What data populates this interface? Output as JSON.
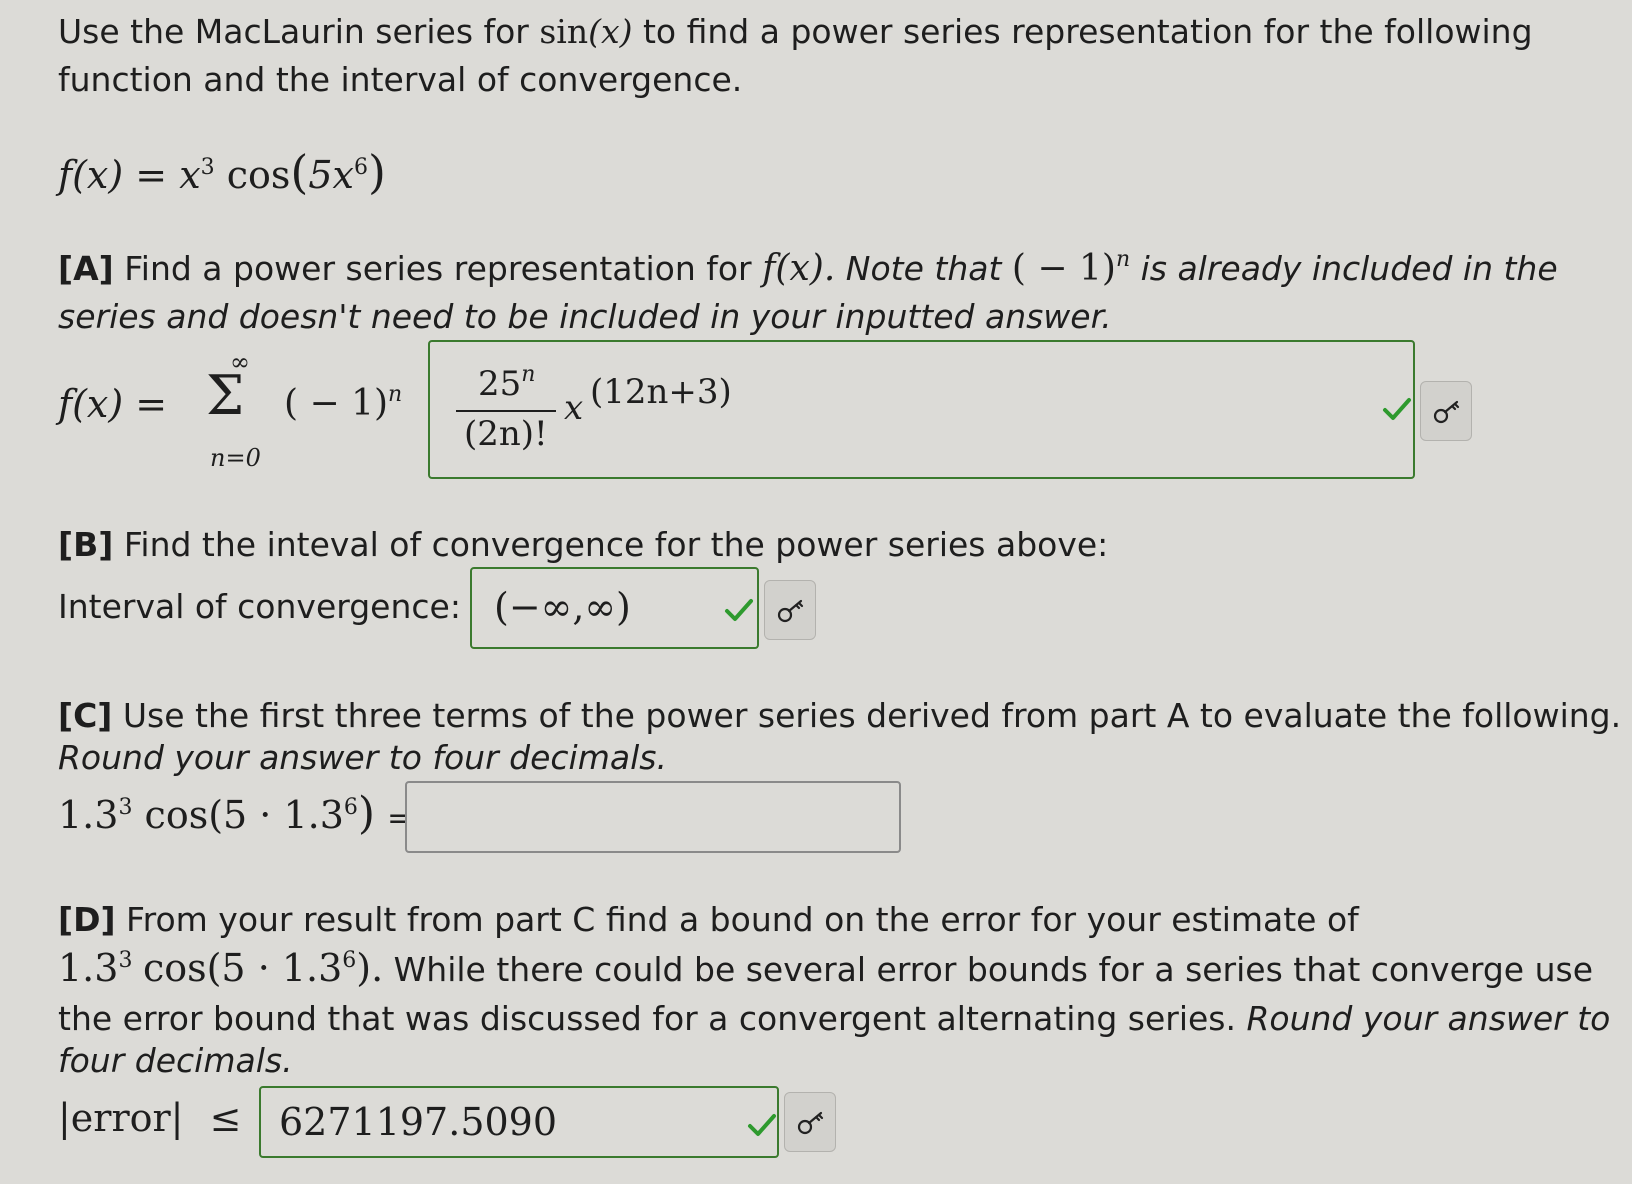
{
  "intro": {
    "line1_pre": "Use the MacLaurin series for ",
    "line1_func": "sin",
    "line1_arg": "(x)",
    "line1_post": " to find a power series representation for the following",
    "line2": "function and the interval of convergence."
  },
  "function_def": {
    "lhs": "f(x)",
    "eq": "=",
    "x": "x",
    "x_exp": "3",
    "cos": "cos",
    "arg_open": "(",
    "coef": "5x",
    "coef_exp": "6",
    "arg_close": ")"
  },
  "partA": {
    "tag": "[A]",
    "text1": " Find a power series representation for ",
    "fx": "f(x).",
    "note1": " Note that ",
    "neg_one": "( − 1)",
    "n_exp": "n",
    "note2": " is already included in the",
    "note3": "series and doesn't need to be included in your inputted answer.",
    "lhs": "f(x)",
    "eq": "=",
    "sigma": "Σ",
    "sum_upper": "∞",
    "sum_lower": "n=0",
    "sign_term": "( − 1)",
    "sign_exp": "n",
    "answer": {
      "numerator": "25",
      "numerator_exp": "n",
      "denominator": "(2n)!",
      "var": "x",
      "var_exp": "(12n+3)"
    }
  },
  "partB": {
    "tag": "[B]",
    "text": " Find the inteval of convergence for the power series above:",
    "label": "Interval of convergence:",
    "answer": "(−∞,∞)"
  },
  "partC": {
    "tag": "[C]",
    "text": " Use the first three terms of the power series derived from part A to evaluate the following.",
    "instruction": "Round your answer to four decimals.",
    "expr_base": "1.3",
    "expr_exp": "3",
    "expr_cos": "cos",
    "expr_arg": "(5 · 1.3",
    "expr_arg_exp": "6",
    "expr_close": ")",
    "eq": "=",
    "answer": ""
  },
  "partD": {
    "tag": "[D]",
    "text1": " From your result from part C find a bound on the error for your estimate of",
    "expr_base": "1.3",
    "expr_exp": "3",
    "expr_cos": "cos",
    "expr_arg": "(5 · 1.3",
    "expr_arg_exp": "6",
    "expr_close": ").",
    "text2": " While there could be several error bounds for a series that converge use",
    "text3": "the error bound that was discussed for a convergent alternating series. ",
    "text3_it": "Round your answer to",
    "text4_it": "four decimals.",
    "error_label": "|error|",
    "leq": "≤",
    "answer": "6271197.5090"
  },
  "colors": {
    "background": "#dcdbd7",
    "correct_border": "#3b7a2e",
    "check": "#2e9a2e",
    "text": "#1e1e1e"
  },
  "icons": {
    "check": "checkmark-icon",
    "key": "key-icon"
  }
}
